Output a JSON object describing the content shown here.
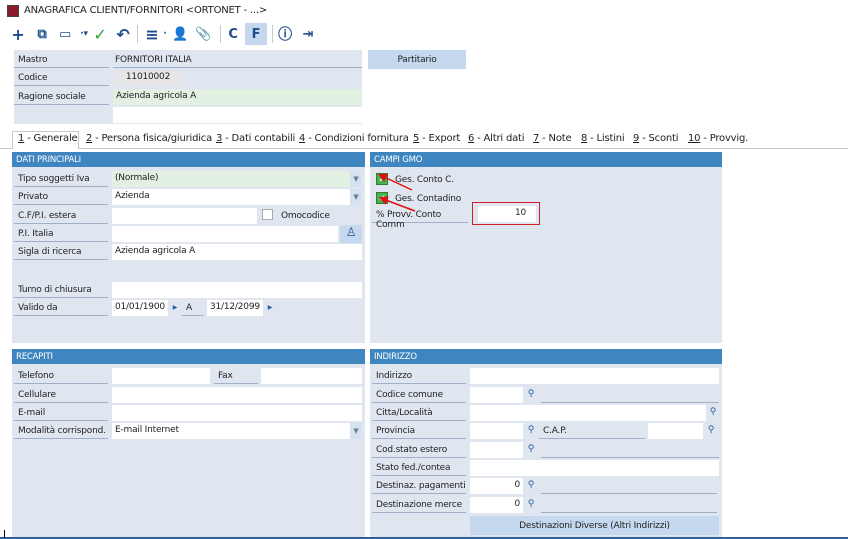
{
  "window": {
    "title": "ANAGRAFICA CLIENTI/FORNITORI <ORTONET - ...>"
  },
  "toolbar": {
    "c_label": "C",
    "f_label": "F"
  },
  "header": {
    "mastro_label": "Mastro",
    "mastro_value": "FORNITORI ITALIA",
    "codice_label": "Codice",
    "codice_value": "11010002",
    "ragione_label": "Ragione sociale",
    "ragione_value": "Azienda agricola A",
    "partitario_button": "Partitario"
  },
  "tabs": [
    {
      "num": "1",
      "label": " - Generale"
    },
    {
      "num": "2",
      "label": " - Persona fisica/giuridica"
    },
    {
      "num": "3",
      "label": " - Dati contabili"
    },
    {
      "num": "4",
      "label": " - Condizioni fornitura"
    },
    {
      "num": "5",
      "label": " - Export"
    },
    {
      "num": "6",
      "label": " - Altri dati"
    },
    {
      "num": "7",
      "label": " - Note"
    },
    {
      "num": "8",
      "label": " - Listini"
    },
    {
      "num": "9",
      "label": " - Sconti"
    },
    {
      "num": "10",
      "label": " - Provvig."
    }
  ],
  "dati_principali": {
    "title": "DATI PRINCIPALI",
    "tipo_label": "Tipo soggetti Iva",
    "tipo_value": "(Normale)",
    "privato_label": "Privato",
    "privato_value": "Azienda",
    "cf_label": "C.F/P.I. estera",
    "omocodice_label": "Omocodice",
    "pi_label": "P.I. Italia",
    "sigla_label": "Sigla di ricerca",
    "sigla_value": "Azienda agricola A",
    "turno_label": "Turno di chiusura",
    "valido_label": "Valido da",
    "valido_da": "01/01/1900",
    "a_label": "A",
    "valido_a": "31/12/2099"
  },
  "campi_gmo": {
    "title": "CAMPI GMO",
    "ges_conto_label": "Ges. Conto C.",
    "ges_conto_checked": true,
    "ges_contadino_label": "Ges. Contadino",
    "ges_contadino_checked": true,
    "provv_label": "% Provv. Conto Comm",
    "provv_value": "10"
  },
  "recapiti": {
    "title": "RECAPITI",
    "telefono_label": "Telefono",
    "fax_label": "Fax",
    "cellulare_label": "Cellulare",
    "email_label": "E-mail",
    "modalita_label": "Modalità corrispond.",
    "modalita_value": "E-mail Internet"
  },
  "indirizzo": {
    "title": "INDIRIZZO",
    "indirizzo_label": "Indirizzo",
    "codice_comune_label": "Codice comune",
    "citta_label": "Citta/Località",
    "provincia_label": "Provincia",
    "cap_label": "C.A.P.",
    "cod_stato_label": "Cod.stato estero",
    "stato_fed_label": "Stato fed./contea",
    "dest_pag_label": "Destinaz. pagamenti",
    "dest_pag_value": "0",
    "dest_merce_label": "Destinazione merce",
    "dest_merce_value": "0",
    "dest_diverse_button": "Destinazioni Diverse (Altri Indirizzi)"
  }
}
